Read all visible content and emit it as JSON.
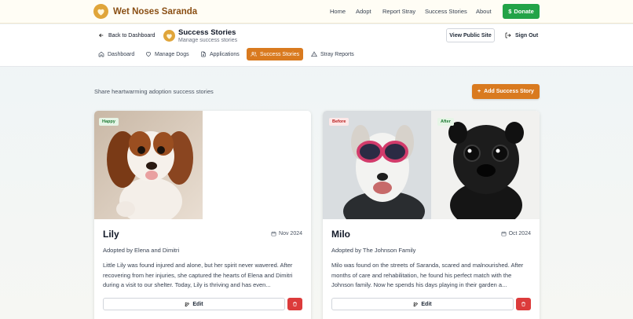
{
  "brand": {
    "name": "Wet Noses Saranda"
  },
  "nav": {
    "links": [
      "Home",
      "Adopt",
      "Report Stray",
      "Success Stories",
      "About"
    ],
    "donate": "Donate",
    "donate_icon": "$"
  },
  "admin": {
    "back": "Back to Dashboard",
    "title": "Success Stories",
    "subtitle": "Manage success stories",
    "view_site": "View Public Site",
    "sign_out": "Sign Out",
    "tabs": [
      "Dashboard",
      "Manage Dogs",
      "Applications",
      "Success Stories",
      "Stray Reports"
    ],
    "active_tab": "Success Stories"
  },
  "main": {
    "intro": "Share heartwarming adoption success stories",
    "add_button": "Add Success Story"
  },
  "stories": [
    {
      "name": "Lily",
      "date": "Nov 2024",
      "adopted_by": "Adopted by Elena and Dimitri",
      "text": "Little Lily was found injured and alone, but her spirit never wavered. After recovering from her injuries, she captured the hearts of Elena and Dimitri during a visit to our shelter. Today, Lily is thriving and has even...",
      "badge": "Happy",
      "edit": "Edit"
    },
    {
      "name": "Milo",
      "date": "Oct 2024",
      "adopted_by": "Adopted by The Johnson Family",
      "text": "Milo was found on the streets of Saranda, scared and malnourished. After months of care and rehabilitation, he found his perfect match with the Johnson family. Now he spends his days playing in their garden a...",
      "badge_before": "Before",
      "badge_after": "After",
      "edit": "Edit"
    }
  ],
  "colors": {
    "accent": "#d97a1f",
    "donate": "#22a348",
    "delete": "#dc3b3b",
    "brand": "#8a4f14"
  }
}
